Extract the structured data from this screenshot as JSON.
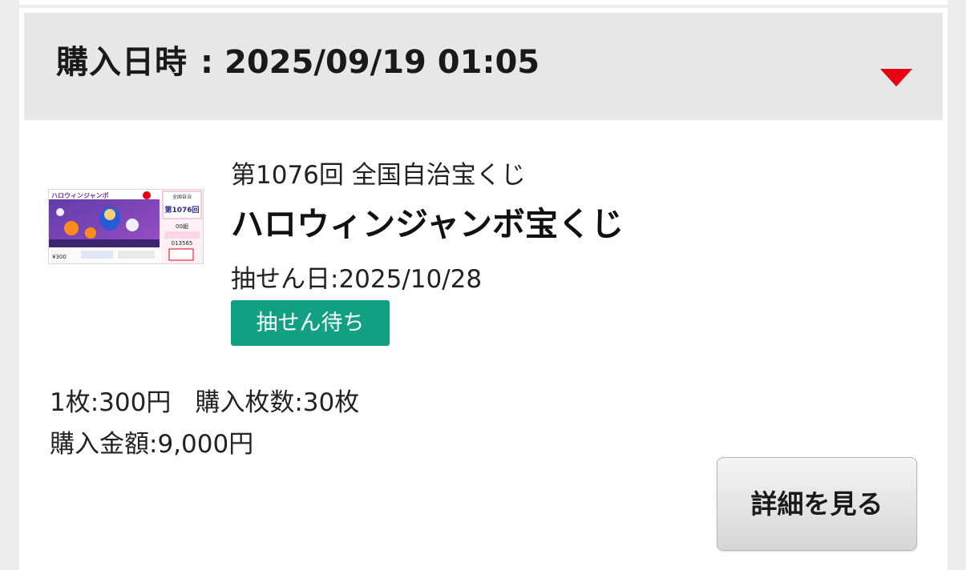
{
  "purchase": {
    "label": "購入日時",
    "separator": ":",
    "datetime": "2025/09/19 01:05"
  },
  "lottery": {
    "round": "第1076回 全国自治宝くじ",
    "name": "ハロウィンジャンボ宝くじ",
    "draw_date_label": "抽せん日:",
    "draw_date": "2025/10/28",
    "status": "抽せん待ち",
    "ticket_image": {
      "banner": "ハロウィンジャンボ",
      "series_label": "全国自治",
      "round_number": "第1076回",
      "group": "00組",
      "serial": "013565",
      "price": "¥300"
    }
  },
  "summary": {
    "unit_price_label": "1枚:",
    "unit_price": "300円",
    "count_label": "購入枚数:",
    "count": "30枚",
    "total_label": "購入金額:",
    "total": "9,000円"
  },
  "actions": {
    "details_label": "詳細を見る"
  },
  "colors": {
    "accent_red": "#e60012",
    "status_green": "#12a085",
    "header_bg": "#e7e7e7"
  },
  "icons": {
    "expand": "triangle-down-icon"
  }
}
